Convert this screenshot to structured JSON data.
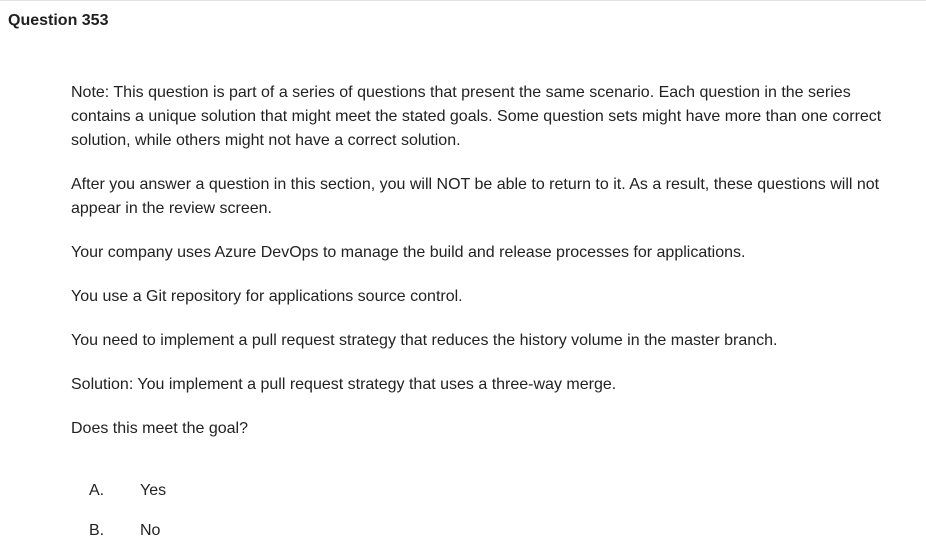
{
  "question": {
    "title": "Question 353",
    "paragraphs": [
      "Note: This question is part of a series of questions that present the same scenario. Each question in the series contains a unique solution that might meet the stated goals. Some question sets might have more than one correct solution, while others might not have a correct solution.",
      "After you answer a question in this section, you will NOT be able to return to it. As a result, these questions will not appear in the review screen.",
      "Your company uses Azure DevOps to manage the build and release processes for applications.",
      "You use a Git repository for applications source control.",
      "You need to implement a pull request strategy that reduces the history volume in the master branch.",
      "Solution: You implement a pull request strategy that uses a three-way merge.",
      "Does this meet the goal?"
    ],
    "choices": [
      {
        "letter": "A.",
        "text": "Yes"
      },
      {
        "letter": "B.",
        "text": "No"
      }
    ]
  }
}
